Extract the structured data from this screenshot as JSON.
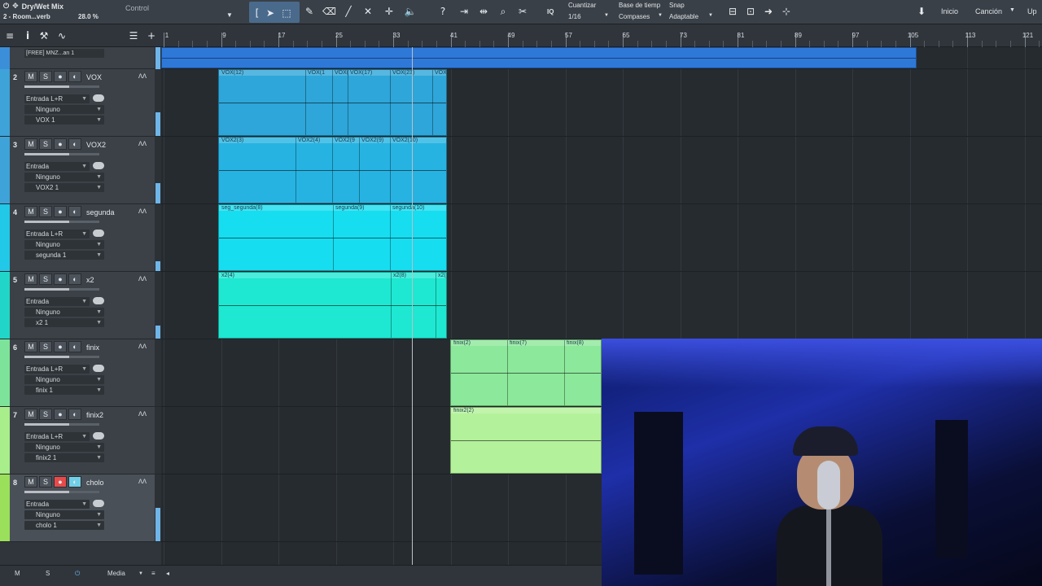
{
  "toolbar": {
    "effect_name": "Dry/Wet Mix",
    "preset": "2 - Room...verb",
    "percent": "28.0 %",
    "control_label": "Control",
    "quantize_label": "Cuantizar",
    "quantize_value": "1/16",
    "timebase_label": "Base de tiemp",
    "timebase_value": "Compases",
    "snap_label": "Snap",
    "snap_value": "Adaptable",
    "iq_label": "IQ",
    "help_icon_glyph": "?",
    "right": {
      "inicio": "Inicio",
      "cancion": "Canción",
      "up": "Up"
    }
  },
  "ruler": {
    "labels": [
      "1",
      "9",
      "17",
      "25",
      "33",
      "41",
      "49",
      "57",
      "65",
      "73",
      "81",
      "89",
      "97",
      "105",
      "113",
      "121"
    ]
  },
  "tracks": [
    {
      "num": "2",
      "name": "VOX",
      "input": "Entrada L+R",
      "output": "Ninguno",
      "layer": "VOX 1",
      "color": "#3ea3d8",
      "meter": 0.35,
      "armed": false
    },
    {
      "num": "3",
      "name": "VOX2",
      "input": "Entrada",
      "output": "Ninguno",
      "layer": "VOX2 1",
      "color": "#3ea3d8",
      "meter": 0.3,
      "armed": false
    },
    {
      "num": "4",
      "name": "segunda",
      "input": "Entrada L+R",
      "output": "Ninguno",
      "layer": "segunda 1",
      "color": "#22c8e8",
      "meter": 0.15,
      "armed": false
    },
    {
      "num": "5",
      "name": "x2",
      "input": "Entrada",
      "output": "Ninguno",
      "layer": "x2 1",
      "color": "#21d6c8",
      "meter": 0.2,
      "armed": false
    },
    {
      "num": "6",
      "name": "finix",
      "input": "Entrada L+R",
      "output": "Ninguno",
      "layer": "finix 1",
      "color": "#7ee39a",
      "meter": 0.0,
      "armed": false
    },
    {
      "num": "7",
      "name": "finix2",
      "input": "Entrada L+R",
      "output": "Ninguno",
      "layer": "finix2 1",
      "color": "#a8ee8a",
      "meter": 0.0,
      "armed": false
    },
    {
      "num": "8",
      "name": "cholo",
      "input": "Entrada",
      "output": "Ninguno",
      "layer": "cholo 1",
      "color": "#9be05a",
      "meter": 0.5,
      "armed": true
    }
  ],
  "track_buttons": {
    "mute": "M",
    "solo": "S"
  },
  "top_track": {
    "layer": "[FREE] MNZ...an 1"
  },
  "events": {
    "vox": [
      "VOX(12)",
      "VOX(1",
      "VOX(",
      "VOX(17)",
      "VOX(23)",
      "VOX"
    ],
    "vox2": [
      "VOX2(3)",
      "VOX2(4)",
      "VOX2(9",
      "VOX2(9)",
      "VOX2(10)"
    ],
    "segunda": [
      "seg_segunda(8)",
      "segunda(9)",
      "segunda(10)"
    ],
    "x2": [
      "x2(4)",
      "x2(8)",
      "x2(9"
    ],
    "finix": [
      "finix(2)",
      "finix(7)",
      "finix(8)"
    ],
    "finix2": [
      "finix2(2)"
    ]
  },
  "bottom": {
    "m": "M",
    "s": "S",
    "media": "Media"
  },
  "icons": [
    "menu-icon",
    "info-icon",
    "wrench-icon",
    "automation-icon",
    "list-icon",
    "add-icon",
    "arrow-tool-icon",
    "range-tool-icon",
    "pencil-tool-icon",
    "eraser-tool-icon",
    "paint-tool-icon",
    "mute-tool-icon",
    "bend-tool-icon",
    "listen-tool-icon",
    "help-icon",
    "loop-icon",
    "zoom-icon",
    "punch-icon"
  ]
}
